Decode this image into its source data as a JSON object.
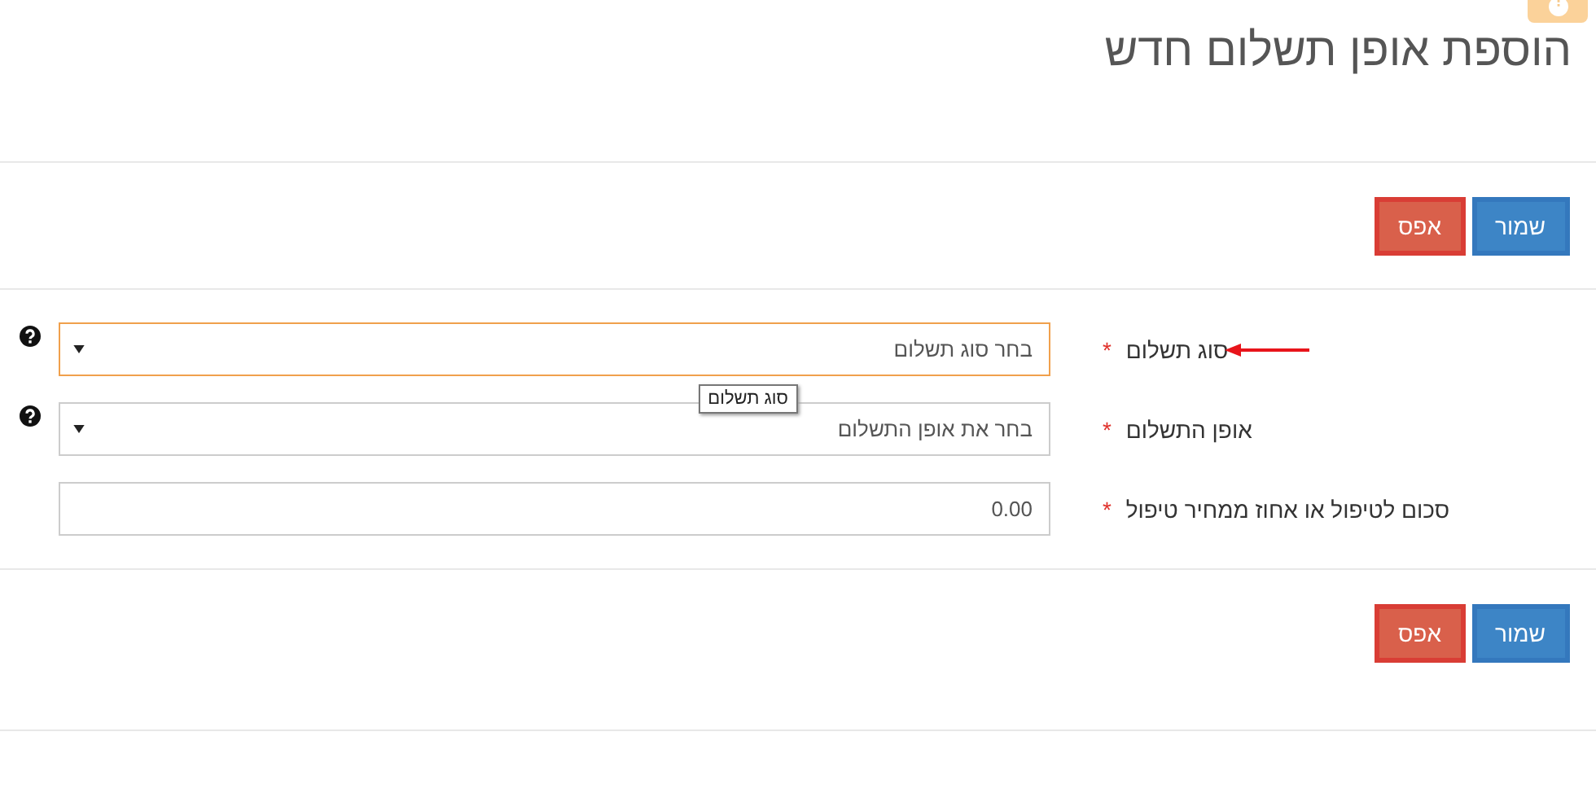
{
  "title": "הוספת אופן תשלום חדש",
  "top_buttons": [
    {
      "label": "שמור",
      "kind": "primary"
    },
    {
      "label": "אפס",
      "kind": "danger"
    }
  ],
  "fields": [
    {
      "label": "סוג תשלום",
      "required_mark": "*",
      "kind": "select",
      "placeholder": "בחר סוג תשלום",
      "focused": true,
      "help": true,
      "annotated": true,
      "tooltip": "סוג תשלום"
    },
    {
      "label": "אופן התשלום",
      "required_mark": "*",
      "kind": "select",
      "placeholder": "בחר את אופן התשלום",
      "focused": false,
      "help": true,
      "annotated": false
    },
    {
      "label": "סכום לטיפול או אחוז ממחיר טיפול",
      "required_mark": "*",
      "kind": "text",
      "value": "0.00",
      "focused": false,
      "help": false,
      "annotated": false
    }
  ],
  "bottom_buttons": [
    {
      "label": "שמור",
      "kind": "primary"
    },
    {
      "label": "אפס",
      "kind": "danger"
    }
  ]
}
